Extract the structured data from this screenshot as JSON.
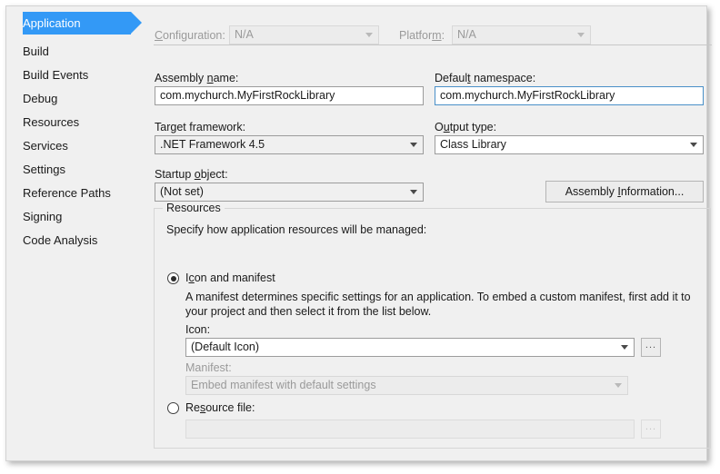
{
  "sidebar": {
    "items": [
      {
        "label": "Application",
        "selected": true
      },
      {
        "label": "Build",
        "selected": false
      },
      {
        "label": "Build Events",
        "selected": false
      },
      {
        "label": "Debug",
        "selected": false
      },
      {
        "label": "Resources",
        "selected": false
      },
      {
        "label": "Services",
        "selected": false
      },
      {
        "label": "Settings",
        "selected": false
      },
      {
        "label": "Reference Paths",
        "selected": false
      },
      {
        "label": "Signing",
        "selected": false
      },
      {
        "label": "Code Analysis",
        "selected": false
      }
    ]
  },
  "top_bar": {
    "configuration_label": "Configuration:",
    "configuration_value": "N/A",
    "platform_label": "Platform:",
    "platform_value": "N/A"
  },
  "form": {
    "assembly_name_label": "Assembly name:",
    "assembly_name_value": "com.mychurch.MyFirstRockLibrary",
    "default_namespace_label": "Default namespace:",
    "default_namespace_value": "com.mychurch.MyFirstRockLibrary",
    "target_framework_label": "Target framework:",
    "target_framework_value": ".NET Framework 4.5",
    "output_type_label": "Output type:",
    "output_type_value": "Class Library",
    "startup_object_label": "Startup object:",
    "startup_object_value": "(Not set)",
    "assembly_information_button": "Assembly Information..."
  },
  "resources": {
    "group_title": "Resources",
    "description": "Specify how application resources will be managed:",
    "icon_manifest_option": "Icon and manifest",
    "icon_manifest_help_line1": "A manifest determines specific settings for an application. To embed a custom manifest, first add it to",
    "icon_manifest_help_line2": "your project and then select it from the list below.",
    "icon_label": "Icon:",
    "icon_value": "(Default Icon)",
    "icon_browse_button": "...",
    "manifest_label": "Manifest:",
    "manifest_value": "Embed manifest with default settings",
    "resource_file_option": "Resource file:",
    "resource_file_value": "",
    "resource_file_browse_button": "..."
  },
  "colors": {
    "accent": "#3399f6",
    "window_bg": "#f0f0f0",
    "focus_border": "#4a90c8",
    "disabled_text": "#9a9a9a"
  }
}
